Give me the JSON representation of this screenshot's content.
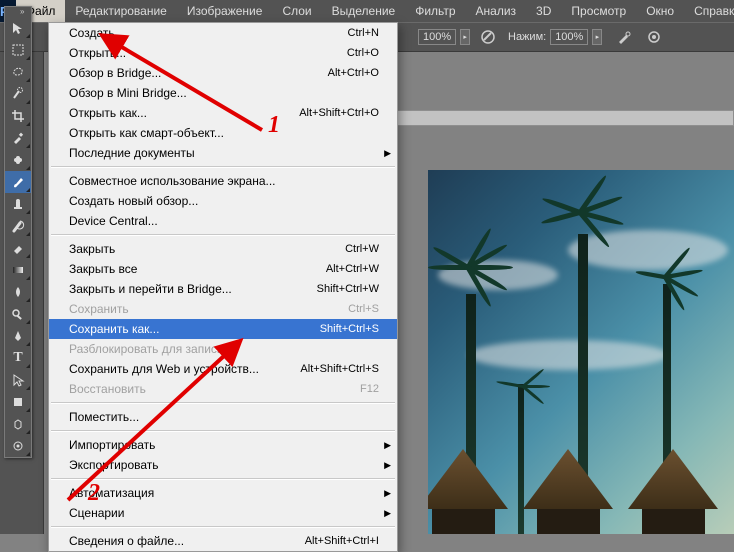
{
  "brand": "Ps",
  "menubar": [
    "Файл",
    "Редактирование",
    "Изображение",
    "Слои",
    "Выделение",
    "Фильтр",
    "Анализ",
    "3D",
    "Просмотр",
    "Окно",
    "Справк"
  ],
  "options": {
    "opacity_label": "",
    "opacity_value": "100%",
    "pressure_label": "Нажим:",
    "pressure_value": "100%"
  },
  "file_menu": [
    {
      "type": "item",
      "label": "Создать...",
      "shortcut": "Ctrl+N"
    },
    {
      "type": "item",
      "label": "Открыть...",
      "shortcut": "Ctrl+O"
    },
    {
      "type": "item",
      "label": "Обзор в Bridge...",
      "shortcut": "Alt+Ctrl+O"
    },
    {
      "type": "item",
      "label": "Обзор в Mini Bridge..."
    },
    {
      "type": "item",
      "label": "Открыть как...",
      "shortcut": "Alt+Shift+Ctrl+O"
    },
    {
      "type": "item",
      "label": "Открыть как смарт-объект..."
    },
    {
      "type": "item",
      "label": "Последние документы",
      "submenu": true
    },
    {
      "type": "sep"
    },
    {
      "type": "item",
      "label": "Совместное использование экрана..."
    },
    {
      "type": "item",
      "label": "Создать новый обзор..."
    },
    {
      "type": "item",
      "label": "Device Central..."
    },
    {
      "type": "sep"
    },
    {
      "type": "item",
      "label": "Закрыть",
      "shortcut": "Ctrl+W"
    },
    {
      "type": "item",
      "label": "Закрыть все",
      "shortcut": "Alt+Ctrl+W"
    },
    {
      "type": "item",
      "label": "Закрыть и перейти в Bridge...",
      "shortcut": "Shift+Ctrl+W"
    },
    {
      "type": "item",
      "label": "Сохранить",
      "shortcut": "Ctrl+S",
      "disabled": true
    },
    {
      "type": "item",
      "label": "Сохранить как...",
      "shortcut": "Shift+Ctrl+S",
      "highlight": true
    },
    {
      "type": "item",
      "label": "Разблокировать для записи...",
      "disabled": true
    },
    {
      "type": "item",
      "label": "Сохранить для Web и устройств...",
      "shortcut": "Alt+Shift+Ctrl+S"
    },
    {
      "type": "item",
      "label": "Восстановить",
      "shortcut": "F12",
      "disabled": true
    },
    {
      "type": "sep"
    },
    {
      "type": "item",
      "label": "Поместить..."
    },
    {
      "type": "sep"
    },
    {
      "type": "item",
      "label": "Импортировать",
      "submenu": true
    },
    {
      "type": "item",
      "label": "Экспортировать",
      "submenu": true
    },
    {
      "type": "sep"
    },
    {
      "type": "item",
      "label": "Автоматизация",
      "submenu": true
    },
    {
      "type": "item",
      "label": "Сценарии",
      "submenu": true
    },
    {
      "type": "sep"
    },
    {
      "type": "item",
      "label": "Сведения о файле...",
      "shortcut": "Alt+Shift+Ctrl+I"
    }
  ],
  "annotations": {
    "one": "1",
    "two": "2"
  }
}
